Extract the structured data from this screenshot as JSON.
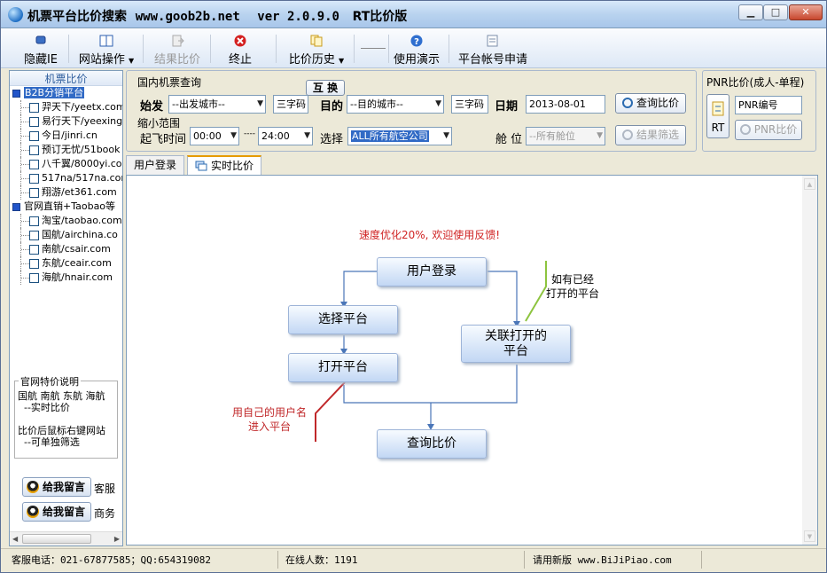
{
  "window": {
    "title_app": "机票平台比价搜索",
    "title_site": "www.goob2b.net",
    "title_version": "ver 2.0.9.0",
    "title_edition": "RT比价版"
  },
  "toolbar": {
    "hide_ie": "隐藏IE",
    "site_ops": "网站操作",
    "compare_result": "结果比价",
    "terminate": "终止",
    "history": "比价历史",
    "demo": "使用演示",
    "apply_account": "平台帐号申请"
  },
  "left_panel": {
    "title": "机票比价",
    "groups": [
      {
        "label": "B2B分销平台",
        "items": [
          "羿天下/yeetx.com",
          "易行天下/yeexing",
          "今日/jinri.cn",
          "预订无忧/51book",
          "八千翼/8000yi.co",
          "517na/517na.com",
          "翔游/et361.com"
        ]
      },
      {
        "label": "官网直销+Taobao等",
        "items": [
          "淘宝/taobao.com",
          "国航/airchina.co",
          "南航/csair.com",
          "东航/ceair.com",
          "海航/hnair.com"
        ]
      }
    ],
    "note_title": "官网特价说明",
    "note_body": "国航 南航 东航 海航\n  --实时比价\n\n比价后鼠标右键网站\n  --可单独筛选",
    "message_button": "给我留言",
    "service_label": "客服",
    "business_label": "商务"
  },
  "search": {
    "section_title": "国内机票查询",
    "swap": "互 换",
    "origin_label": "始发",
    "origin_value": "--出发城市--",
    "code_label": "三字码",
    "dest_label": "目的",
    "dest_value": "--目的城市--",
    "date_label": "日期",
    "date_value": "2013-08-01",
    "search_button": "查询比价",
    "narrow_label": "缩小范围",
    "time_label": "起飞时间",
    "time_from": "00:00",
    "time_sep": "----",
    "time_to": "24:00",
    "choose_label": "选择",
    "airline_value": "ALL所有航空公司",
    "cabin_label": "舱 位",
    "cabin_value": "--所有舱位",
    "filter_button": "结果筛选"
  },
  "pnr": {
    "title": "PNR比价(成人-单程)",
    "rt_label": "RT",
    "input_value": "PNR编号",
    "compare_button": "PNR比价"
  },
  "tabs": {
    "login": "用户登录",
    "realtime": "实时比价"
  },
  "flow": {
    "promo": "速度优化20%, 欢迎使用反馈!",
    "login": "用户登录",
    "select": "选择平台",
    "open": "打开平台",
    "link": "关联打开的\n平台",
    "query": "查询比价",
    "note_right": "如有已经\n打开的平台",
    "note_left": "用自己的用户名\n进入平台"
  },
  "status": {
    "contact": "客服电话：021-67877585；QQ:654319082",
    "online_label": "在线人数：",
    "online_count": "1191",
    "new_version": "请用新版 www.BiJiPiao.com"
  },
  "colors": {
    "accent_blue": "#316ac5",
    "promo_red": "#d02424",
    "annotation_green": "#8dc43f",
    "annotation_red": "#c0282a"
  }
}
